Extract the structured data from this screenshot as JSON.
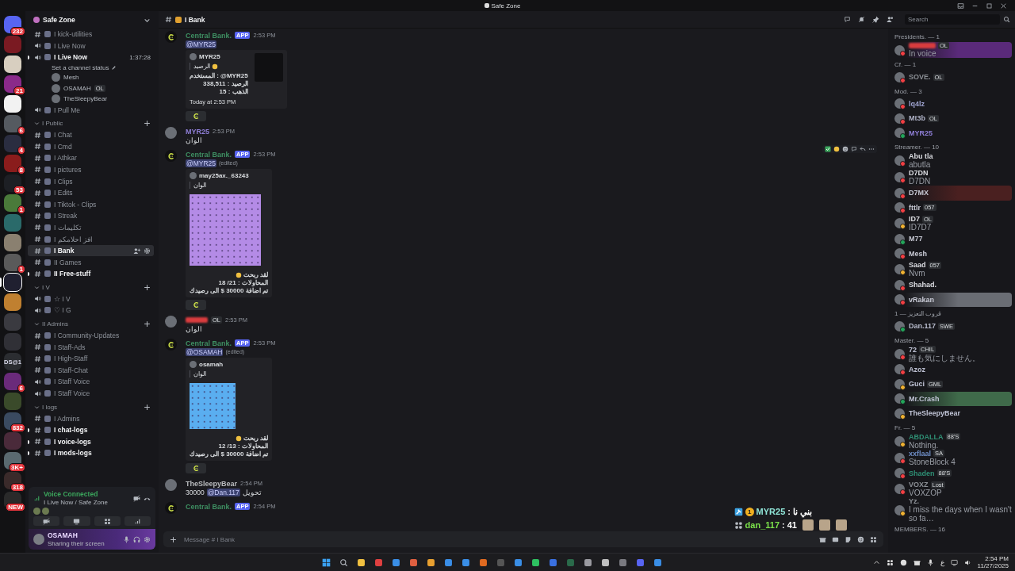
{
  "titlebar": {
    "title": "Safe Zone"
  },
  "rail": [
    {
      "selected": false,
      "badge": "232"
    },
    {
      "selected": false
    },
    {
      "selected": false
    },
    {
      "selected": false,
      "badge": "21"
    },
    {
      "selected": false
    },
    {
      "selected": false,
      "badge": "6"
    },
    {
      "selected": false,
      "badge": "4"
    },
    {
      "selected": false,
      "badge": "8"
    },
    {
      "selected": false,
      "badge": "53"
    },
    {
      "selected": false,
      "badge": "1"
    },
    {
      "selected": false
    },
    {
      "selected": false
    },
    {
      "selected": false,
      "badge": "1"
    },
    {
      "selected": true
    },
    {
      "selected": false
    },
    {
      "selected": false
    },
    {
      "selected": false
    },
    {
      "selected": false,
      "label": "DS@1"
    },
    {
      "selected": false,
      "badge": "6"
    },
    {
      "selected": false
    },
    {
      "selected": false,
      "badge": "832"
    },
    {
      "selected": false
    },
    {
      "selected": false,
      "badge": "3K+"
    },
    {
      "selected": false,
      "badge": "318"
    },
    {
      "selected": false,
      "badge": "NEW"
    }
  ],
  "sidebar": {
    "server": "Safe Zone",
    "channels": [
      {
        "kind": "text",
        "name": "I kick-utilities",
        "unread": false,
        "selected": false
      },
      {
        "kind": "voice",
        "name": "I Live Now",
        "unread": false,
        "selected": false
      },
      {
        "kind": "voice",
        "name": "I Live Now",
        "unread": true,
        "selected": false,
        "time": "1:37:28",
        "status": "Set a channel status",
        "users": [
          {
            "name": "Mesh"
          },
          {
            "name": "OSAMAH",
            "tag": "OL"
          },
          {
            "name": "TheSleepyBear"
          }
        ]
      },
      {
        "kind": "voice",
        "name": "I Pull Me",
        "unread": false,
        "selected": false
      },
      {
        "kind": "category",
        "name": "I Public",
        "children": [
          {
            "kind": "text",
            "name": "I Chat",
            "unread": false,
            "selected": false
          },
          {
            "kind": "text",
            "name": "I Cmd",
            "unread": false,
            "selected": false
          },
          {
            "kind": "text",
            "name": "I Athkar",
            "unread": false,
            "selected": false
          },
          {
            "kind": "text",
            "name": "I pictures",
            "unread": false,
            "selected": false
          },
          {
            "kind": "text",
            "name": "I Clips",
            "unread": false,
            "selected": false
          },
          {
            "kind": "text",
            "name": "I Edits",
            "unread": false,
            "selected": false
          },
          {
            "kind": "text",
            "name": "I Tiktok - Clips",
            "unread": false,
            "selected": false
          },
          {
            "kind": "text",
            "name": "I Streak",
            "unread": false,
            "selected": false
          },
          {
            "kind": "text",
            "name": "I تكليمات",
            "unread": false,
            "selected": false
          },
          {
            "kind": "text",
            "name": "I افز احلامكم",
            "unread": false,
            "selected": false
          },
          {
            "kind": "text",
            "name": "I Bank",
            "unread": false,
            "selected": true
          },
          {
            "kind": "text",
            "name": "II Games",
            "unread": false,
            "selected": false
          },
          {
            "kind": "text",
            "name": "II Free-stuff",
            "unread": true,
            "selected": false
          }
        ]
      },
      {
        "kind": "category",
        "name": "I V",
        "children": [
          {
            "kind": "voice",
            "name": "☆ I V",
            "unread": false,
            "selected": false
          },
          {
            "kind": "voice",
            "name": "♡ I G",
            "unread": false,
            "selected": false
          }
        ]
      },
      {
        "kind": "category",
        "name": "II Admins",
        "children": [
          {
            "kind": "text",
            "name": "I Community-Updates",
            "unread": false,
            "selected": false
          },
          {
            "kind": "text",
            "name": "I Staff-Ads",
            "unread": false,
            "selected": false
          },
          {
            "kind": "text",
            "name": "I High-Staff",
            "unread": false,
            "selected": false
          },
          {
            "kind": "text",
            "name": "I Staff-Chat",
            "unread": false,
            "selected": false
          },
          {
            "kind": "voice",
            "name": "I Staff Voice",
            "unread": false,
            "selected": false
          },
          {
            "kind": "voice",
            "name": "I Staff Voice",
            "unread": false,
            "selected": false
          }
        ]
      },
      {
        "kind": "category",
        "name": "I logs",
        "children": [
          {
            "kind": "text",
            "name": "I Admins",
            "unread": false,
            "selected": false
          },
          {
            "kind": "text",
            "name": "I chat-logs",
            "unread": true,
            "selected": false
          },
          {
            "kind": "text",
            "name": "I voice-logs",
            "unread": true,
            "selected": false
          },
          {
            "kind": "text",
            "name": "I mods-logs",
            "unread": true,
            "selected": false
          }
        ]
      }
    ],
    "voice_panel": {
      "title": "Voice Connected",
      "location": "I Live Now / Safe Zone"
    },
    "user_panel": {
      "name": "OSAMAH",
      "status": "Sharing their screen"
    }
  },
  "channel_header": {
    "name": "I Bank",
    "search_placeholder": "Search"
  },
  "messages": [
    {
      "kind": "bot",
      "author": "Central Bank.",
      "color": "#3e8f62",
      "app_tag": "APP",
      "time": "2:53 PM",
      "mention": "@MYR25",
      "embed": {
        "author": "MYR25",
        "quote": "الرصيد",
        "quote_emoji": true,
        "lines": [
          {
            "text": "المستخدم : @MYR25",
            "emoji": false
          },
          {
            "text": "الرصيد : 338,511",
            "emoji": false
          },
          {
            "text": "الذهب : 15",
            "emoji": false
          }
        ],
        "footer": "Today at 2:53 PM",
        "thumbnail": true
      },
      "bot_button": true
    },
    {
      "kind": "user",
      "author": "MYR25",
      "color": "#8e7ed6",
      "time": "2:53 PM",
      "content": [
        {
          "kind": "text",
          "text": "الوان"
        }
      ]
    },
    {
      "kind": "bot",
      "author": "Central Bank.",
      "color": "#3e8f62",
      "app_tag": "APP",
      "time": "2:53 PM",
      "mention": "@MYR25",
      "edited_label": "(edited)",
      "hover_toolbar": true,
      "embed": {
        "author": "may25ax._63243",
        "quote": "الوان",
        "quote_emoji": false,
        "image": {
          "kind": "large",
          "color": "#b48be6"
        },
        "lines": [
          {
            "text": "لقد ربحت",
            "emoji": true
          },
          {
            "text": "المحاولات : 21/ 18",
            "emoji": false
          },
          {
            "text": "تم اضافة 30000 $ الى رصيدك",
            "emoji": false
          }
        ]
      },
      "bot_button": true
    },
    {
      "kind": "user",
      "author_hidden": true,
      "color": "#d83c3e",
      "tag": "OL",
      "time": "2:53 PM",
      "content": [
        {
          "kind": "text",
          "text": "الوان"
        }
      ]
    },
    {
      "kind": "bot",
      "author": "Central Bank.",
      "color": "#3e8f62",
      "app_tag": "APP",
      "time": "2:53 PM",
      "mention": "@OSAMAH",
      "edited_label": "(edited)",
      "embed": {
        "author": "osamah",
        "quote": "الوان",
        "quote_emoji": false,
        "image": {
          "kind": "small",
          "color": "#5aaef0"
        },
        "lines": [
          {
            "text": "لقد ربحت",
            "emoji": true
          },
          {
            "text": "المحاولات : 13/ 12",
            "emoji": false
          },
          {
            "text": "تم اضافة 30000 $ الى رصيدك",
            "emoji": false
          }
        ]
      },
      "bot_button": true
    },
    {
      "kind": "user",
      "author": "TheSleepyBear",
      "color": "#b9bbbe",
      "time": "2:54 PM",
      "content": [
        {
          "kind": "text",
          "text": "30000"
        },
        {
          "kind": "mention",
          "text": "@Dan.117"
        },
        {
          "kind": "text",
          "text": "تحويل"
        }
      ]
    },
    {
      "kind": "bot",
      "author": "Central Bank.",
      "color": "#3e8f62",
      "app_tag": "APP",
      "time": "2:54 PM"
    }
  ],
  "stream_overlay": [
    {
      "rank": "1",
      "user": "MYR25",
      "color": "#8fe3d6",
      "message": ": بني نا"
    },
    {
      "user": "dan_117",
      "color": "#7be04a",
      "message": ": 41",
      "emotes": [
        {
          "kind": "image"
        },
        {
          "kind": "image"
        },
        {
          "kind": "image"
        }
      ]
    }
  ],
  "composer": {
    "placeholder": "Message # I Bank"
  },
  "members": {
    "groups": [
      {
        "title": "Presidents. — 1",
        "members": [
          {
            "name_hidden": true,
            "color": "#d83c3e",
            "presence": {
              "color": "#f23f43"
            },
            "tag": "OL",
            "sub": "In voice",
            "banner": {
              "color": "#5a2a7a"
            }
          }
        ]
      },
      {
        "title": "Cf. — 1",
        "members": [
          {
            "name": "SOVE.",
            "color": "#8a8e94",
            "presence": {
              "color": "#f23f43"
            },
            "tag": "OL"
          }
        ]
      },
      {
        "title": "Mod. — 3",
        "members": [
          {
            "name": "lq4lz",
            "color": "#9ea3cf",
            "presence": {
              "color": "#f23f43"
            }
          },
          {
            "name": "Mt3b",
            "color": "#b0b3c8",
            "presence": {
              "color": "#f23f43"
            },
            "tag": "OL"
          },
          {
            "name": "MYR25",
            "color": "#8e7ed6",
            "presence": {
              "color": "#23a55a"
            }
          }
        ]
      },
      {
        "title": "Streamer. — 10",
        "members": [
          {
            "name": "Abu tla",
            "color": "#dcdde2",
            "presence": {
              "color": "#f23f43"
            },
            "sub": "abutla"
          },
          {
            "name": "D7DN",
            "color": "#dcdde2",
            "presence": {
              "color": "#f23f43"
            },
            "sub": "D7DN"
          },
          {
            "name": "D7MX",
            "color": "#c9cbd6",
            "presence": {
              "color": "#f23f43"
            },
            "banner": {
              "color": "#4a2020"
            }
          },
          {
            "name": "fttlr",
            "color": "#c9cbd6",
            "presence": {
              "color": "#f23f43"
            },
            "tag": "057"
          },
          {
            "name": "ID7",
            "color": "#dcdde2",
            "presence": {
              "color": "#f0b232"
            },
            "tag": "OL",
            "sub": "ID7D7"
          },
          {
            "name": "M77",
            "color": "#c9cbd6",
            "presence": {
              "color": "#23a55a"
            }
          },
          {
            "name": "Mesh",
            "color": "#c9cbd6",
            "presence": {
              "color": "#f23f43"
            }
          },
          {
            "name": "Saad",
            "color": "#dcdde2",
            "presence": {
              "color": "#f0b232"
            },
            "tag": "057",
            "sub": "Nvm"
          },
          {
            "name": "Shahad.",
            "color": "#dcdde2",
            "presence": {
              "color": "#f23f43"
            }
          },
          {
            "name": "vRakan",
            "color": "#c9cbd6",
            "presence": {
              "color": "#f23f43"
            },
            "banner": {
              "color": "#6a6d74"
            }
          }
        ]
      },
      {
        "title": "قروب التعزيز — 1",
        "members": [
          {
            "name": "Dan.117",
            "color": "#b8bccd",
            "presence": {
              "color": "#23a55a"
            },
            "tag": "SWE"
          }
        ]
      },
      {
        "title": "Master. — 5",
        "members": [
          {
            "name": "72",
            "color": "#c0c4d6",
            "presence": {
              "color": "#f23f43"
            },
            "tag": "CHIL",
            "sub": "誰も気にしません。"
          },
          {
            "name": "Azoz",
            "color": "#c0c4d6",
            "presence": {
              "color": "#f23f43"
            }
          },
          {
            "name": "Guci",
            "color": "#c0c4d6",
            "presence": {
              "color": "#f0b232"
            },
            "tag": "GML"
          },
          {
            "name": "Mr.Crash",
            "color": "#c0c4d6",
            "presence": {
              "color": "#23a55a"
            },
            "banner": {
              "color": "#3f6a4a"
            }
          },
          {
            "name": "TheSleepyBear",
            "color": "#c0c4d6",
            "presence": {
              "color": "#f0b232"
            }
          }
        ]
      },
      {
        "title": "Fr. — 5",
        "members": [
          {
            "name": "ABDALLA",
            "color": "#2e8f74",
            "presence": {
              "color": "#f0b232"
            },
            "tag": "88'S",
            "sub": "Nothing."
          },
          {
            "name": "xxflaal",
            "color": "#6f8fc8",
            "presence": {
              "color": "#f23f43"
            },
            "tag": "SA",
            "sub": "StoneBlock 4"
          },
          {
            "name": "Shaden",
            "color": "#2e8f74",
            "presence": {
              "color": "#f23f43"
            },
            "tag": "88'S"
          },
          {
            "name": "VOXZ",
            "color": "#8a8e94",
            "presence": {
              "color": "#f23f43"
            },
            "tag": "Lost",
            "sub": "VOXZOP"
          },
          {
            "name": "Yz.",
            "color": "#8a8e94",
            "presence": {
              "color": "#f0b232"
            },
            "sub": "I miss the days when I wasn't so fa…"
          }
        ]
      }
    ],
    "footer": "MEMBERS. — 16"
  },
  "taskbar": {
    "language": "ع",
    "time": "2:54 PM",
    "date": "11/27/2025"
  }
}
